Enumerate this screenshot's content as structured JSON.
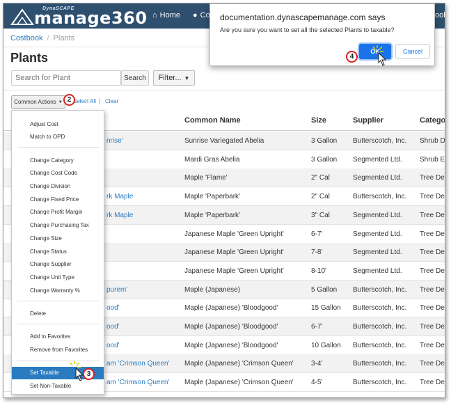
{
  "nav": {
    "logo_tm": "DynaSCAPE",
    "logo_word": "manage360",
    "home": "Home",
    "item2": "Co",
    "item3": "ook"
  },
  "breadcrumb": {
    "root": "Costbook",
    "current": "Plants"
  },
  "page_title": "Plants",
  "search": {
    "placeholder": "Search for Plant",
    "button": "Search",
    "filter": "Filter..."
  },
  "actions": {
    "label": "Common Actions",
    "select_all": "Select All",
    "clear": "Clear"
  },
  "columns": [
    "Common Name",
    "Size",
    "Supplier",
    "Categor"
  ],
  "rows": [
    {
      "bot": "nrise'",
      "common": "Sunrise Variegated Abelia",
      "size": "3 Gallon",
      "supplier": "Butterscotch, Inc.",
      "category": "Shrub D"
    },
    {
      "bot": "",
      "common": "Mardi Gras Abelia",
      "size": "3 Gallon",
      "supplier": "Segmented Ltd.",
      "category": "Shrub E"
    },
    {
      "bot": "",
      "common": "Maple 'Flame'",
      "size": "2\" Cal",
      "supplier": "Segmented Ltd.",
      "category": "Tree De"
    },
    {
      "bot": "rk Maple",
      "common": "Maple 'Paperbark'",
      "size": "2\" Cal",
      "supplier": "Butterscotch, Inc.",
      "category": "Tree De"
    },
    {
      "bot": "rk Maple",
      "common": "Maple 'Paperbark'",
      "size": "3\" Cal",
      "supplier": "Segmented Ltd.",
      "category": "Tree De"
    },
    {
      "bot": "",
      "common": "Japanese Maple 'Green Upright'",
      "size": "6-7'",
      "supplier": "Segmented Ltd.",
      "category": "Tree De"
    },
    {
      "bot": "",
      "common": "Japanese Maple 'Green Upright'",
      "size": "7-8'",
      "supplier": "Segmented Ltd.",
      "category": "Tree De"
    },
    {
      "bot": "",
      "common": "Japanese Maple 'Green Upright'",
      "size": "8-10'",
      "supplier": "Segmented Ltd.",
      "category": "Tree De"
    },
    {
      "bot": "purem'",
      "common": "Maple (Japanese)",
      "size": "5 Gallon",
      "supplier": "Butterscotch, Inc.",
      "category": "Tree De"
    },
    {
      "bot": "ood'",
      "common": "Maple (Japanese) 'Bloodgood'",
      "size": "15 Gallon",
      "supplier": "Butterscotch, Inc.",
      "category": "Tree De"
    },
    {
      "bot": "ood'",
      "common": "Maple (Japanese) 'Bloodgood'",
      "size": "6-7'",
      "supplier": "Butterscotch, Inc.",
      "category": "Tree De"
    },
    {
      "bot": "ood'",
      "common": "Maple (Japanese) 'Bloodgood'",
      "size": "10 Gallon",
      "supplier": "Butterscotch, Inc.",
      "category": "Tree De"
    },
    {
      "bot": "am 'Crimson Queen'",
      "common": "Maple (Japanese) 'Crimson Queen'",
      "size": "3-4'",
      "supplier": "Butterscotch, Inc.",
      "category": "Tree De"
    },
    {
      "bot": "am 'Crimson Queen'",
      "common": "Maple (Japanese) 'Crimson Queen'",
      "size": "4-5'",
      "supplier": "Butterscotch, Inc.",
      "category": "Tree De"
    }
  ],
  "menu": {
    "items": [
      "Adjust Cost",
      "Match to OPD",
      "Change Category",
      "Change Cost Code",
      "Change Division",
      "Change Fixed Price",
      "Change Profit Margin",
      "Change Purchasing Tax",
      "Change Size",
      "Change Status",
      "Change Supplier",
      "Change Unit Type",
      "Change Warranty %",
      "Delete",
      "Add to Favorites",
      "Remove from Favorites",
      "Set Taxable",
      "Set Non-Taxable"
    ]
  },
  "dialog": {
    "title": "documentation.dynascapemanage.com says",
    "message": "Are you sure you want to set all the selected Plants to taxable?",
    "ok": "OK",
    "cancel": "Cancel"
  },
  "callouts": [
    "2",
    "3",
    "4"
  ],
  "colors": {
    "navbar": "#2f4f6f",
    "link": "#2a7bbf",
    "ok": "#1a73e8",
    "callout": "#dd2222"
  }
}
